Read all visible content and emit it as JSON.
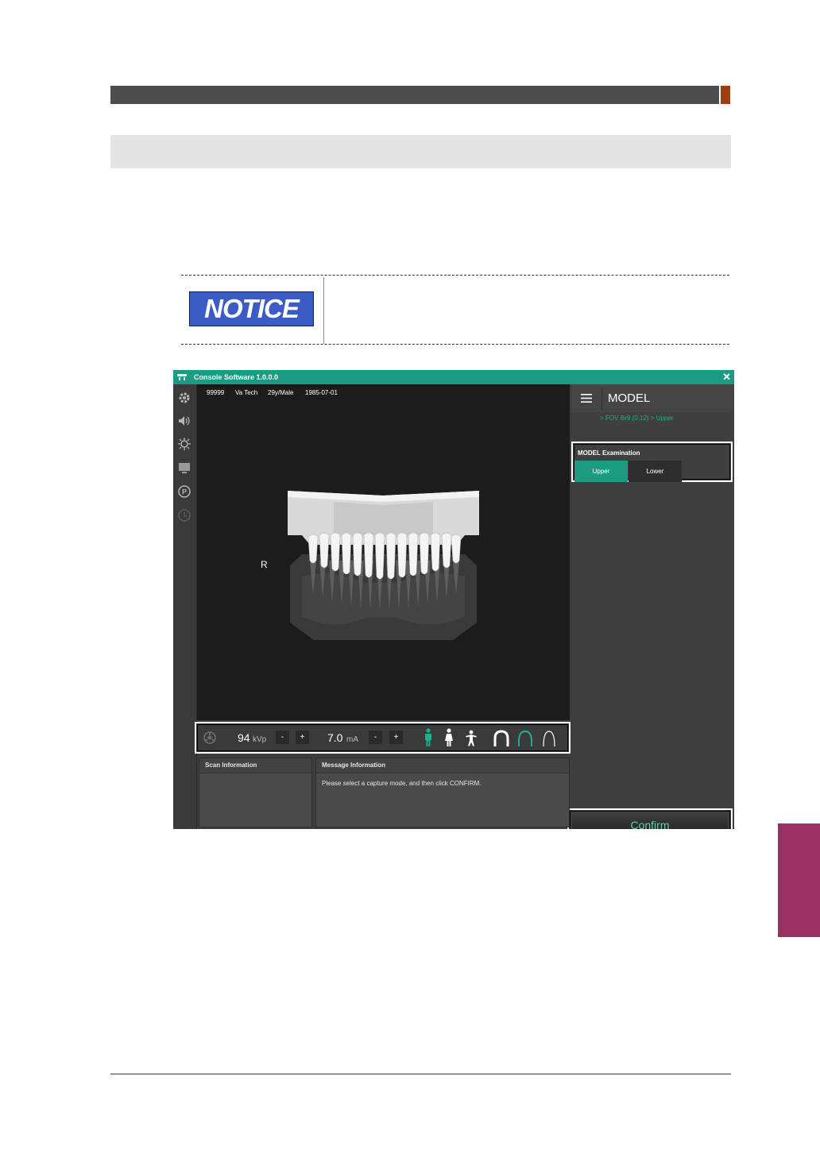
{
  "notice_label": "NOTICE",
  "app": {
    "title": "Console Software  1.0.0.0",
    "close_glyph": "✕",
    "patient": {
      "id": "99999",
      "name": "Va Tech",
      "age_sex": "29y/Male",
      "dob": "1985-07-01"
    },
    "orientation_mark": "R",
    "menu": {
      "title": "MODEL",
      "path": "> FOV 8x9 (0.12) > Upper"
    },
    "exam": {
      "label": "MODEL Examination",
      "options": [
        "Upper",
        "Lower"
      ],
      "selected": "Upper"
    },
    "confirm_label": "Confirm",
    "params": {
      "kvp_value": "94",
      "kvp_unit": "kVp",
      "ma_value": "7.0",
      "ma_unit": "mA",
      "minus": "-",
      "plus": "+"
    },
    "scan_info_title": "Scan Information",
    "message_title": "Message Information",
    "message_text": "Please select a capture mode, and then click CONFIRM."
  },
  "colors": {
    "accent": "#1a9b82",
    "header": "#4d4d4d",
    "side_tab": "#9b2f62",
    "notice": "#3b5cc4"
  },
  "icons": [
    "settings-gear-icon",
    "speaker-icon",
    "laser-icon",
    "monitor-icon",
    "preset-p-icon",
    "clock-icon",
    "xray-emitter-icon",
    "adult-male-icon",
    "adult-female-icon",
    "child-icon",
    "arch-wide-icon",
    "arch-normal-icon",
    "arch-narrow-icon",
    "hamburger-icon"
  ]
}
